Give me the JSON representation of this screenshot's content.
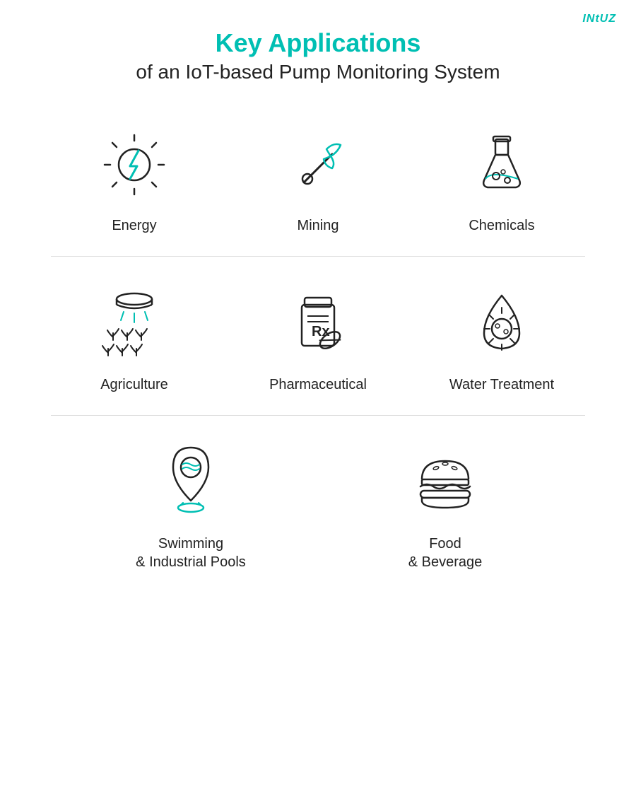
{
  "brand": "INtUZ",
  "header": {
    "line1": "Key Applications",
    "line2": "of an IoT-based Pump Monitoring System"
  },
  "sections": [
    {
      "items": [
        {
          "id": "energy",
          "label": "Energy"
        },
        {
          "id": "mining",
          "label": "Mining"
        },
        {
          "id": "chemicals",
          "label": "Chemicals"
        }
      ]
    },
    {
      "items": [
        {
          "id": "agriculture",
          "label": "Agriculture"
        },
        {
          "id": "pharmaceutical",
          "label": "Pharmaceutical"
        },
        {
          "id": "water-treatment",
          "label": "Water Treatment"
        }
      ]
    },
    {
      "items": [
        {
          "id": "swimming-pools",
          "label": "Swimming\n& Industrial Pools"
        },
        {
          "id": "food-beverage",
          "label": "Food\n& Beverage"
        }
      ]
    }
  ],
  "accent_color": "#00BFB3",
  "dark_color": "#222222"
}
